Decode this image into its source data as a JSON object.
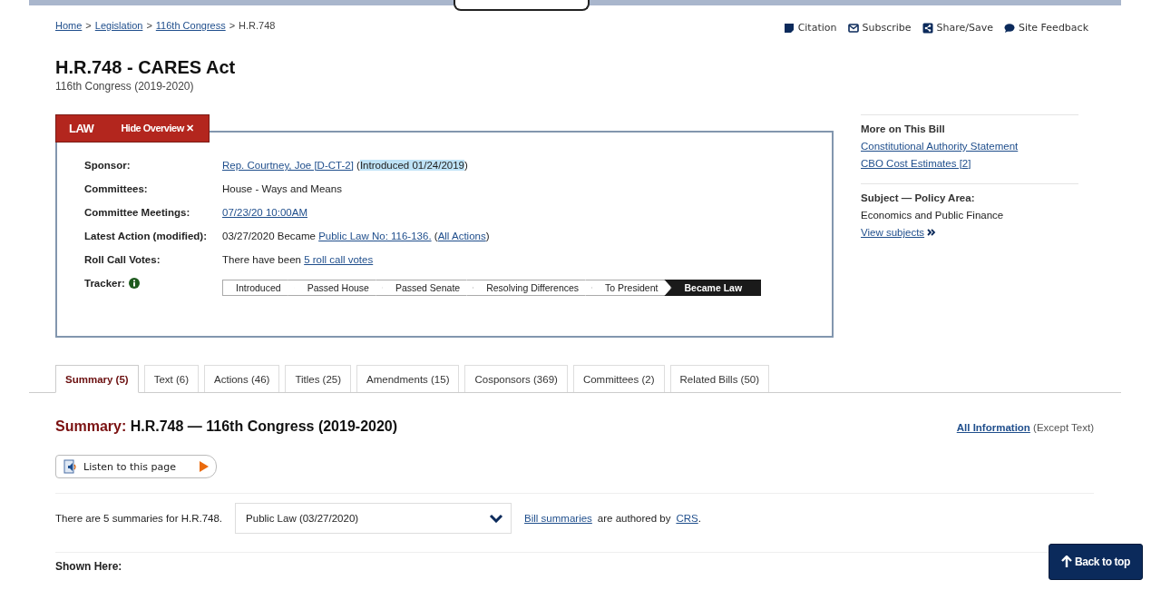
{
  "breadcrumb": [
    {
      "label": "Home",
      "link": true
    },
    {
      "label": "Legislation",
      "link": true
    },
    {
      "label": "116th Congress",
      "link": true
    },
    {
      "label": "H.R.748",
      "link": false
    }
  ],
  "breadcrumb_separator": ">",
  "tools": [
    {
      "kind": "citation",
      "label": "Citation"
    },
    {
      "kind": "subscribe",
      "label": "Subscribe"
    },
    {
      "kind": "share",
      "label": "Share/Save"
    },
    {
      "kind": "feedback",
      "label": "Site Feedback"
    }
  ],
  "title": "H.R.748 - CARES Act",
  "subtitle": "116th Congress (2019-2020)",
  "overview": {
    "status": "LAW",
    "toggle": "Hide Overview ✕",
    "rows": [
      {
        "label": "Sponsor:",
        "parts": [
          {
            "kind": "link",
            "text": "Rep. Courtney, Joe [D-CT-2]"
          },
          {
            "kind": "text",
            "text": " ("
          },
          {
            "kind": "highlight",
            "text": "Introduced 01/24/2019"
          },
          {
            "kind": "text",
            "text": ")"
          }
        ]
      },
      {
        "label": "Committees:",
        "parts": [
          {
            "kind": "text",
            "text": "House - Ways and Means"
          }
        ]
      },
      {
        "label": "Committee Meetings:",
        "parts": [
          {
            "kind": "link",
            "text": "07/23/20 10:00AM"
          }
        ]
      },
      {
        "label": "Latest Action (modified):",
        "parts": [
          {
            "kind": "text",
            "text": "03/27/2020 Became "
          },
          {
            "kind": "link",
            "text": "Public Law No: 116-136."
          },
          {
            "kind": "text",
            "text": "  ("
          },
          {
            "kind": "link",
            "text": "All Actions"
          },
          {
            "kind": "text",
            "text": ")"
          }
        ]
      },
      {
        "label": "Roll Call Votes:",
        "parts": [
          {
            "kind": "text",
            "text": "There have been "
          },
          {
            "kind": "link",
            "text": "5 roll call votes"
          }
        ]
      }
    ],
    "tracker_label": "Tracker:",
    "tracker": [
      {
        "label": "Introduced",
        "selected": false
      },
      {
        "label": "Passed House",
        "selected": false
      },
      {
        "label": "Passed Senate",
        "selected": false
      },
      {
        "label": "Resolving Differences",
        "selected": false
      },
      {
        "label": "To President",
        "selected": false
      },
      {
        "label": "Became Law",
        "selected": true
      }
    ]
  },
  "sidebar": {
    "more_title": "More on This Bill",
    "more_links": [
      "Constitutional Authority Statement",
      "CBO Cost Estimates [2]"
    ],
    "subject_title": "Subject — Policy Area:",
    "subject": "Economics and Public Finance",
    "subject_link": "View subjects"
  },
  "tabs": [
    {
      "label": "Summary (5)",
      "selected": true
    },
    {
      "label": "Text (6)",
      "selected": false
    },
    {
      "label": "Actions (46)",
      "selected": false
    },
    {
      "label": "Titles (25)",
      "selected": false
    },
    {
      "label": "Amendments (15)",
      "selected": false
    },
    {
      "label": "Cosponsors (369)",
      "selected": false
    },
    {
      "label": "Committees (2)",
      "selected": false
    },
    {
      "label": "Related Bills (50)",
      "selected": false
    }
  ],
  "summary": {
    "heading_label": "Summary:",
    "heading": "H.R.748 — 116th Congress (2019-2020)",
    "all_info_link": "All Information",
    "all_info_note": "(Except Text)",
    "listen": "Listen to this page",
    "count_text": "There are 5 summaries for H.R.748.",
    "version_select": "Public Law (03/27/2020)",
    "authored_link": "Bill summaries",
    "authored_text": "are authored by",
    "crs_link": "CRS",
    "crs_end": ".",
    "shown_here": "Shown Here:"
  },
  "back_to_top": "Back to top"
}
